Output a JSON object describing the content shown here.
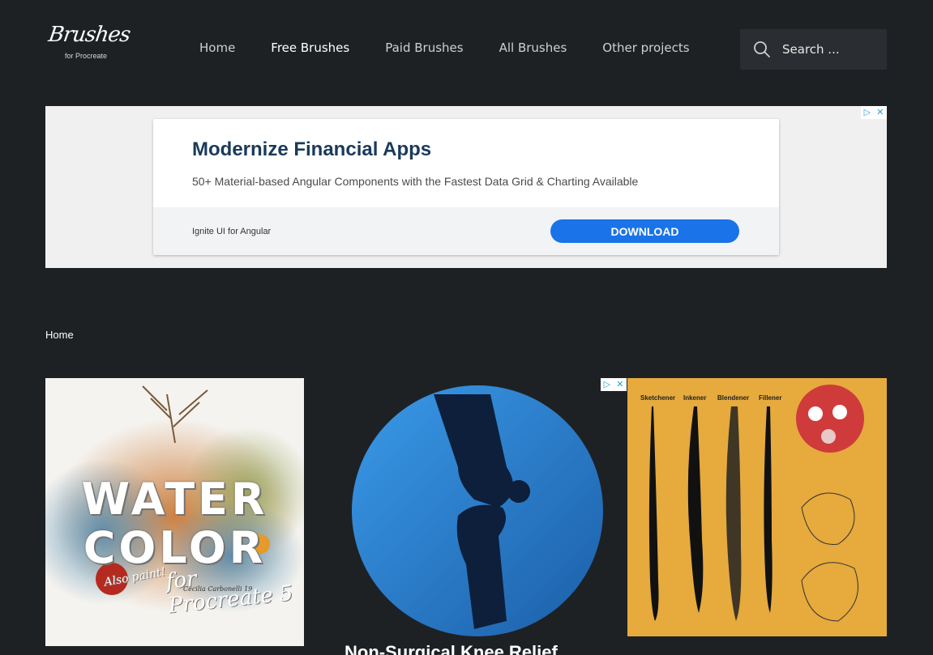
{
  "header": {
    "logo_script": "Brushes",
    "logo_sub": "for Procreate",
    "nav": [
      {
        "label": "Home",
        "active": false
      },
      {
        "label": "Free Brushes",
        "active": true
      },
      {
        "label": "Paid Brushes",
        "active": false
      },
      {
        "label": "All Brushes",
        "active": false
      },
      {
        "label": "Other projects",
        "active": false
      }
    ],
    "search_placeholder": "Search ..."
  },
  "ad": {
    "title": "Modernize Financial Apps",
    "description": "50+ Material-based Angular Components with the Fastest Data Grid & Charting Available",
    "brand": "Ignite UI for Angular",
    "cta": "DOWNLOAD",
    "choices_icon": "ad-choices-icon",
    "close_glyph": "✕"
  },
  "breadcrumb": "Home",
  "cards": {
    "watercolor": {
      "line1": "WATER",
      "line2": "COLOR",
      "sub": "Also paint!",
      "sub2": "for Procreate 5",
      "signature": "Cecilia Carbonelli 19"
    },
    "knee_ad": {
      "title": "Non-Surgical Knee Relief"
    },
    "brushes": {
      "labels": [
        "Sketchener",
        "Inkener",
        "Blendener",
        "Fillener"
      ]
    }
  },
  "colors": {
    "background": "#1e2124",
    "ad_button": "#1a73e8",
    "knee_blue": "#2f86d6",
    "brush_card": "#e6aa3d"
  }
}
